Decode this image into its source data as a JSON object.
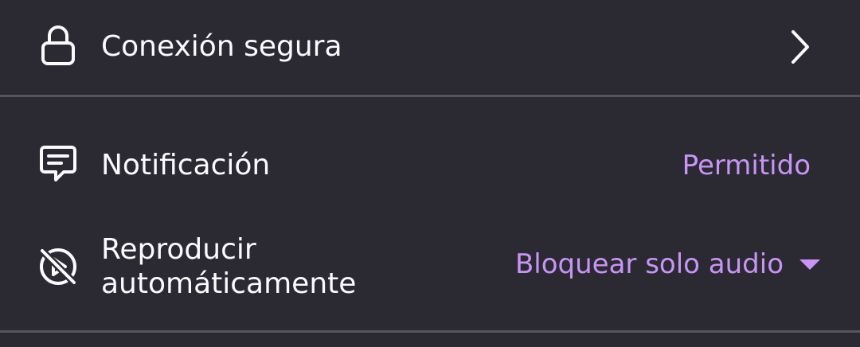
{
  "secure_connection": {
    "label": "Conexión segura",
    "icon": "lock-icon"
  },
  "notification": {
    "label": "Notificación",
    "value": "Permitido",
    "icon": "notification-icon"
  },
  "autoplay": {
    "label_line1": "Reproducir",
    "label_line2": "automáticamente",
    "value": "Bloquear solo audio",
    "icon": "autoplay-blocked-icon"
  },
  "colors": {
    "background": "#2b2a33",
    "text": "#fbfbfe",
    "accent": "#c895f6",
    "divider": "#55545c"
  }
}
